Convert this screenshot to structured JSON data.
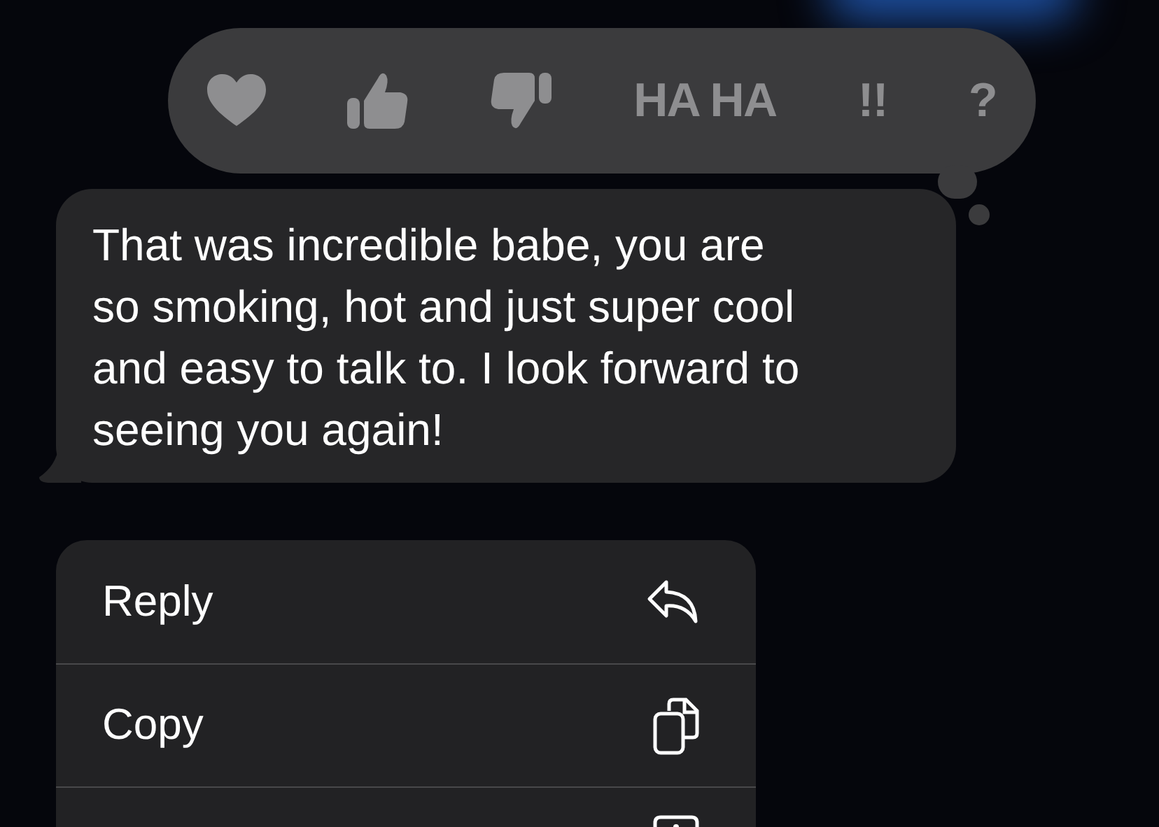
{
  "reactions": [
    {
      "kind": "heart"
    },
    {
      "kind": "thumbs_up"
    },
    {
      "kind": "thumbs_down"
    },
    {
      "kind": "text",
      "label": "HA HA"
    },
    {
      "kind": "text",
      "label": "!!"
    },
    {
      "kind": "text",
      "label": "?"
    }
  ],
  "message": {
    "text": "That was incredible babe, you are so smoking, hot and just super cool and easy to talk to. I look forward to seeing you again!"
  },
  "menu": [
    {
      "kind": "reply",
      "label": "Reply"
    },
    {
      "kind": "copy",
      "label": "Copy"
    },
    {
      "kind": "info"
    }
  ]
}
